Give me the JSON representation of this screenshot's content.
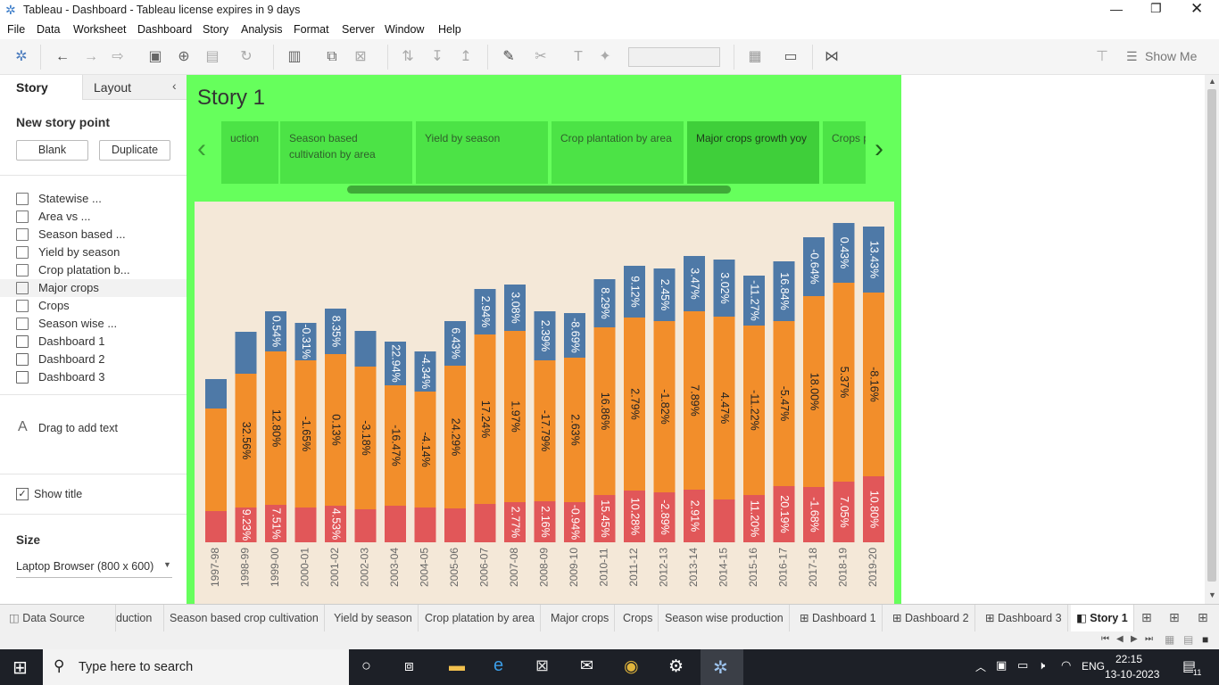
{
  "window": {
    "title": "Tableau - Dashboard - Tableau license expires in 9 days"
  },
  "menu": [
    "File",
    "Data",
    "Worksheet",
    "Dashboard",
    "Story",
    "Analysis",
    "Format",
    "Server",
    "Window",
    "Help"
  ],
  "toolbar": {
    "show_me": "Show Me"
  },
  "left": {
    "tab_story": "Story",
    "tab_layout": "Layout",
    "new_story_point": "New story point",
    "blank": "Blank",
    "duplicate": "Duplicate",
    "sheets": [
      "Statewise ...",
      "Area vs ...",
      "Season based ...",
      "Yield by season",
      "Crop platation b...",
      "Major crops",
      "Crops",
      "Season wise ...",
      "Dashboard 1",
      "Dashboard 2",
      "Dashboard 3"
    ],
    "drag_text": "Drag to add text",
    "show_title": "Show title",
    "size_label": "Size",
    "size_value": "Laptop Browser (800 x 600)"
  },
  "story": {
    "title": "Story 1",
    "points": [
      "uction",
      "Season based cultivation by area",
      "Yield by season",
      "Crop plantation by area",
      "Major crops growth yoy",
      "Crops p count"
    ]
  },
  "chart_data": {
    "type": "bar",
    "stacked": true,
    "categories": [
      "1997-98",
      "1998-99",
      "1999-00",
      "2000-01",
      "2001-02",
      "2002-03",
      "2003-04",
      "2004-05",
      "2005-06",
      "2006-07",
      "2007-08",
      "2008-09",
      "2009-10",
      "2010-11",
      "2011-12",
      "2012-13",
      "2013-14",
      "2014-15",
      "2015-16",
      "2016-17",
      "2017-18",
      "2018-19",
      "2019-20"
    ],
    "colors": {
      "red": "#e15759",
      "orange": "#f28e2b",
      "blue": "#4e79a7"
    },
    "series": [
      {
        "values": [
          35,
          39,
          42,
          39,
          41,
          37,
          41,
          39,
          38,
          43,
          45,
          46,
          45,
          53,
          58,
          56,
          59,
          48,
          53,
          63,
          62,
          68,
          74
        ],
        "labels": [
          "",
          "9.23%",
          "7.51%",
          "",
          "4.53%",
          "",
          "",
          "",
          "",
          "",
          "2.77%",
          "2.16%",
          "-0.94%",
          "15.45%",
          "10.28%",
          "-2.89%",
          "2.91%",
          "",
          "11.20%",
          "20.19%",
          "-1.68%",
          "7.05%",
          "10.80%"
        ]
      },
      {
        "values": [
          115,
          150,
          172,
          165,
          170,
          160,
          135,
          130,
          160,
          190,
          192,
          158,
          162,
          188,
          194,
          192,
          200,
          205,
          190,
          185,
          214,
          223,
          206
        ],
        "labels": [
          "",
          "32.56%",
          "12.80%",
          "-1.65%",
          "0.13%",
          "-3.18%",
          "-16.47%",
          "-4.14%",
          "24.29%",
          "17.24%",
          "1.97%",
          "-17.79%",
          "2.63%",
          "16.86%",
          "2.79%",
          "-1.82%",
          "7.89%",
          "4.47%",
          "-11.22%",
          "-5.47%",
          "18.00%",
          "5.37%",
          "-8.16%"
        ]
      },
      {
        "values": [
          33,
          47,
          45,
          42,
          51,
          40,
          49,
          45,
          50,
          51,
          52,
          55,
          50,
          54,
          58,
          59,
          62,
          64,
          56,
          67,
          66,
          67,
          74
        ],
        "labels": [
          "",
          "",
          "0.54%",
          "-0.31%",
          "8.35%",
          "",
          "22.94%",
          "-4.34%",
          "6.43%",
          "2.94%",
          "3.08%",
          "2.39%",
          "-8.69%",
          "8.29%",
          "9.12%",
          "2.45%",
          "3.47%",
          "3.02%",
          "-11.27%",
          "16.84%",
          "-0.64%",
          "0.43%",
          "13.43%"
        ]
      }
    ]
  },
  "bottom_tabs": [
    "Data Source",
    "duction",
    "Season based crop cultivation",
    "Yield by season",
    "Crop platation by area",
    "Major crops",
    "Crops",
    "Season wise production",
    "Dashboard 1",
    "Dashboard 2",
    "Dashboard 3",
    "Story 1"
  ],
  "taskbar": {
    "search_placeholder": "Type here to search",
    "lang": "ENG",
    "time": "22:15",
    "date": "13-10-2023",
    "notif": "11"
  }
}
